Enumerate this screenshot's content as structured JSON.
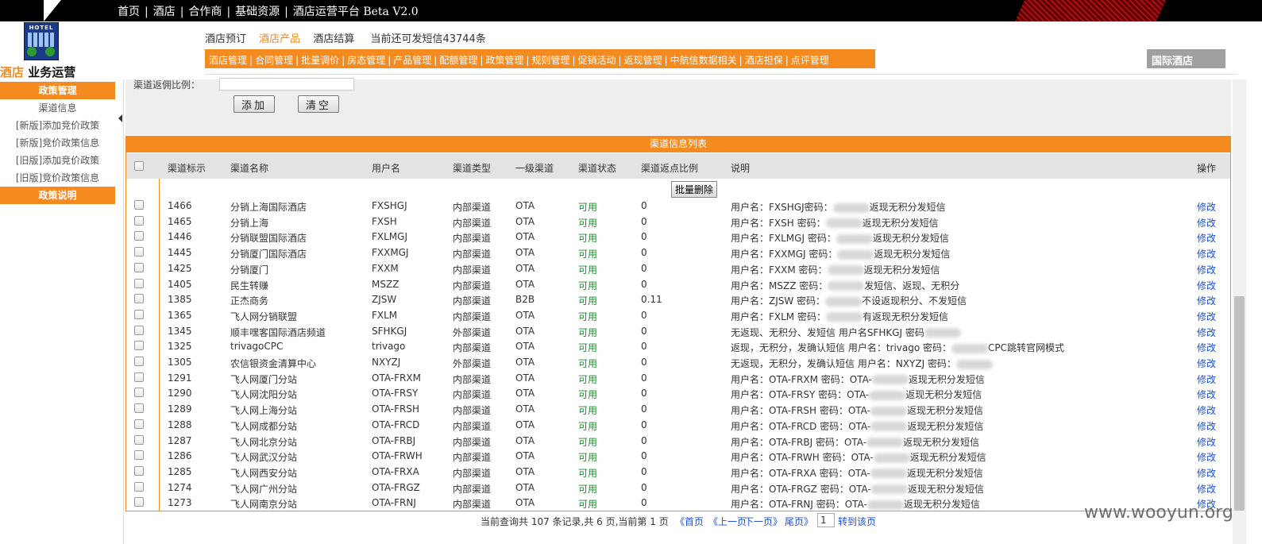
{
  "top_nav": {
    "items": [
      "首页",
      "酒店",
      "合作商",
      "基础资源"
    ],
    "platform": "酒店运营平台 Beta V2.0"
  },
  "logo": {
    "label": "HOTEL"
  },
  "brand": {
    "orange": "酒店",
    "black": " 业务运营"
  },
  "sub_nav": {
    "items": [
      "酒店预订",
      "酒店产品",
      "酒店结算"
    ],
    "active": "酒店产品",
    "sms_text": "当前还可发短信43744条"
  },
  "menu": {
    "items": [
      "酒店管理",
      "合同管理",
      "批量调价",
      "房态管理",
      "产品管理",
      "配额管理",
      "政策管理",
      "规则管理",
      "促销活动",
      "返现管理",
      "中航信数据相关",
      "酒店担保",
      "点评管理"
    ],
    "right_label": "国际酒店"
  },
  "sidebar": {
    "header": "政策管理",
    "items": [
      "渠道信息",
      "[新版]添加竞价政策",
      "[新版]竞价政策信息",
      "[旧版]添加竞价政策",
      "[旧版]竞价政策信息"
    ],
    "footer": "政策说明"
  },
  "form": {
    "label": "渠道返佣比例：",
    "add_button": "添加",
    "clear_button": "清空"
  },
  "list": {
    "title": "渠道信息列表",
    "batch_delete": "批量删除",
    "headers": [
      "渠道标示",
      "渠道名称",
      "用户名",
      "渠道类型",
      "一级渠道",
      "渠道状态",
      "渠道返点比例",
      "说明",
      "操作"
    ],
    "rows": [
      {
        "id": "1466",
        "name": "分销上海国际酒店",
        "user": "FXSHGJ",
        "type": "内部渠道",
        "level1": "OTA",
        "status": "可用",
        "ratio": "0",
        "desc_a": "用户名：FXSHGJ密码：",
        "desc_b": "返现无积分发短信",
        "op": "修改"
      },
      {
        "id": "1465",
        "name": "分销上海",
        "user": "FXSH",
        "type": "内部渠道",
        "level1": "OTA",
        "status": "可用",
        "ratio": "0",
        "desc_a": "用户名：FXSH 密码：",
        "desc_b": "返现无积分发短信",
        "op": "修改"
      },
      {
        "id": "1446",
        "name": "分销联盟国际酒店",
        "user": "FXLMGJ",
        "type": "内部渠道",
        "level1": "OTA",
        "status": "可用",
        "ratio": "0",
        "desc_a": "用户名：FXLMGJ 密码：",
        "desc_b": "返现无积分发短信",
        "op": "修改"
      },
      {
        "id": "1445",
        "name": "分销厦门国际酒店",
        "user": "FXXMGJ",
        "type": "内部渠道",
        "level1": "OTA",
        "status": "可用",
        "ratio": "0",
        "desc_a": "用户名：FXXMGJ 密码：",
        "desc_b": "返现无积分发短信",
        "op": "修改"
      },
      {
        "id": "1425",
        "name": "分销厦门",
        "user": "FXXM",
        "type": "内部渠道",
        "level1": "OTA",
        "status": "可用",
        "ratio": "0",
        "desc_a": "用户名：FXXM 密码：",
        "desc_b": "返现无积分发短信",
        "op": "修改"
      },
      {
        "id": "1405",
        "name": "民生转赚",
        "user": "MSZZ",
        "type": "内部渠道",
        "level1": "OTA",
        "status": "可用",
        "ratio": "0",
        "desc_a": "用户名：MSZZ 密码：",
        "desc_b": "发短信、返现、无积分",
        "op": "修改"
      },
      {
        "id": "1385",
        "name": "正杰商务",
        "user": "ZJSW",
        "type": "内部渠道",
        "level1": "B2B",
        "status": "可用",
        "ratio": "0.11",
        "desc_a": "用户名：ZJSW 密码：",
        "desc_b": "不设返现积分、不发短信",
        "op": "修改"
      },
      {
        "id": "1365",
        "name": "飞人网分销联盟",
        "user": "FXLM",
        "type": "内部渠道",
        "level1": "OTA",
        "status": "可用",
        "ratio": "0",
        "desc_a": "用户名：FXLM 密码：",
        "desc_b": "有返现无积分发短信",
        "op": "修改"
      },
      {
        "id": "1345",
        "name": "顺丰嘿客国际酒店频道",
        "user": "SFHKGJ",
        "type": "外部渠道",
        "level1": "OTA",
        "status": "可用",
        "ratio": "0",
        "desc_a": "无返现、无积分、发短信 用户名SFHKGJ 密码",
        "desc_b": "",
        "op": "修改"
      },
      {
        "id": "1325",
        "name": "trivagoCPC",
        "user": "trivago",
        "type": "内部渠道",
        "level1": "OTA",
        "status": "可用",
        "ratio": "0",
        "desc_a": "返现，无积分，发确认短信 用户名：trivago 密码：",
        "desc_b": "CPC跳转官网模式",
        "op": "修改"
      },
      {
        "id": "1305",
        "name": "农信银资金清算中心",
        "user": "NXYZJ",
        "type": "外部渠道",
        "level1": "OTA",
        "status": "可用",
        "ratio": "0",
        "desc_a": "无返现，无积分，发确认短信 用户名：NXYZJ 密码：",
        "desc_b": "",
        "op": "修改"
      },
      {
        "id": "1291",
        "name": "飞人网厦门分站",
        "user": "OTA-FRXM",
        "type": "内部渠道",
        "level1": "OTA",
        "status": "可用",
        "ratio": "0",
        "desc_a": "用户名：OTA-FRXM 密码：OTA-",
        "desc_b": "返现无积分发短信",
        "op": "修改"
      },
      {
        "id": "1290",
        "name": "飞人网沈阳分站",
        "user": "OTA-FRSY",
        "type": "内部渠道",
        "level1": "OTA",
        "status": "可用",
        "ratio": "0",
        "desc_a": "用户名：OTA-FRSY 密码：OTA-",
        "desc_b": "返现无积分发短信",
        "op": "修改"
      },
      {
        "id": "1289",
        "name": "飞人网上海分站",
        "user": "OTA-FRSH",
        "type": "内部渠道",
        "level1": "OTA",
        "status": "可用",
        "ratio": "0",
        "desc_a": "用户名：OTA-FRSH 密码：OTA-",
        "desc_b": "返现无积分发短信",
        "op": "修改"
      },
      {
        "id": "1288",
        "name": "飞人网成都分站",
        "user": "OTA-FRCD",
        "type": "内部渠道",
        "level1": "OTA",
        "status": "可用",
        "ratio": "0",
        "desc_a": "用户名：OTA-FRCD 密码：OTA-",
        "desc_b": "返现无积分发短信",
        "op": "修改"
      },
      {
        "id": "1287",
        "name": "飞人网北京分站",
        "user": "OTA-FRBJ",
        "type": "内部渠道",
        "level1": "OTA",
        "status": "可用",
        "ratio": "0",
        "desc_a": "用户名：OTA-FRBJ 密码：OTA-",
        "desc_b": "返现无积分发短信",
        "op": "修改"
      },
      {
        "id": "1286",
        "name": "飞人网武汉分站",
        "user": "OTA-FRWH",
        "type": "内部渠道",
        "level1": "OTA",
        "status": "可用",
        "ratio": "0",
        "desc_a": "用户名：OTA-FRWH 密码：OTA-",
        "desc_b": "返现无积分发短信",
        "op": "修改"
      },
      {
        "id": "1285",
        "name": "飞人网西安分站",
        "user": "OTA-FRXA",
        "type": "内部渠道",
        "level1": "OTA",
        "status": "可用",
        "ratio": "0",
        "desc_a": "用户名：OTA-FRXA 密码：OTA-",
        "desc_b": "返现无积分发短信",
        "op": "修改"
      },
      {
        "id": "1274",
        "name": "飞人网广州分站",
        "user": "OTA-FRGZ",
        "type": "内部渠道",
        "level1": "OTA",
        "status": "可用",
        "ratio": "0",
        "desc_a": "用户名：OTA-FRGZ 密码：OTA-",
        "desc_b": "返现无积分发短信",
        "op": "修改"
      },
      {
        "id": "1273",
        "name": "飞人网南京分站",
        "user": "OTA-FRNJ",
        "type": "内部渠道",
        "level1": "OTA",
        "status": "可用",
        "ratio": "0",
        "desc_a": "用户名：OTA-FRNJ 密码：OTA-",
        "desc_b": "返现无积分发短信",
        "op": "修改"
      }
    ]
  },
  "pager": {
    "summary": "当前查询共 107 条记录,共 6 页,当前第 1 页",
    "first": "《首页",
    "prev": "《上一页",
    "next": "下一页》",
    "last": "尾页》",
    "page_value": "1",
    "go": "转到该页"
  },
  "watermark": "www.wooyun.org",
  "colors": {
    "accent": "#f58a1f",
    "status_ok": "#1e8c2e",
    "link": "#1a4fd6"
  }
}
